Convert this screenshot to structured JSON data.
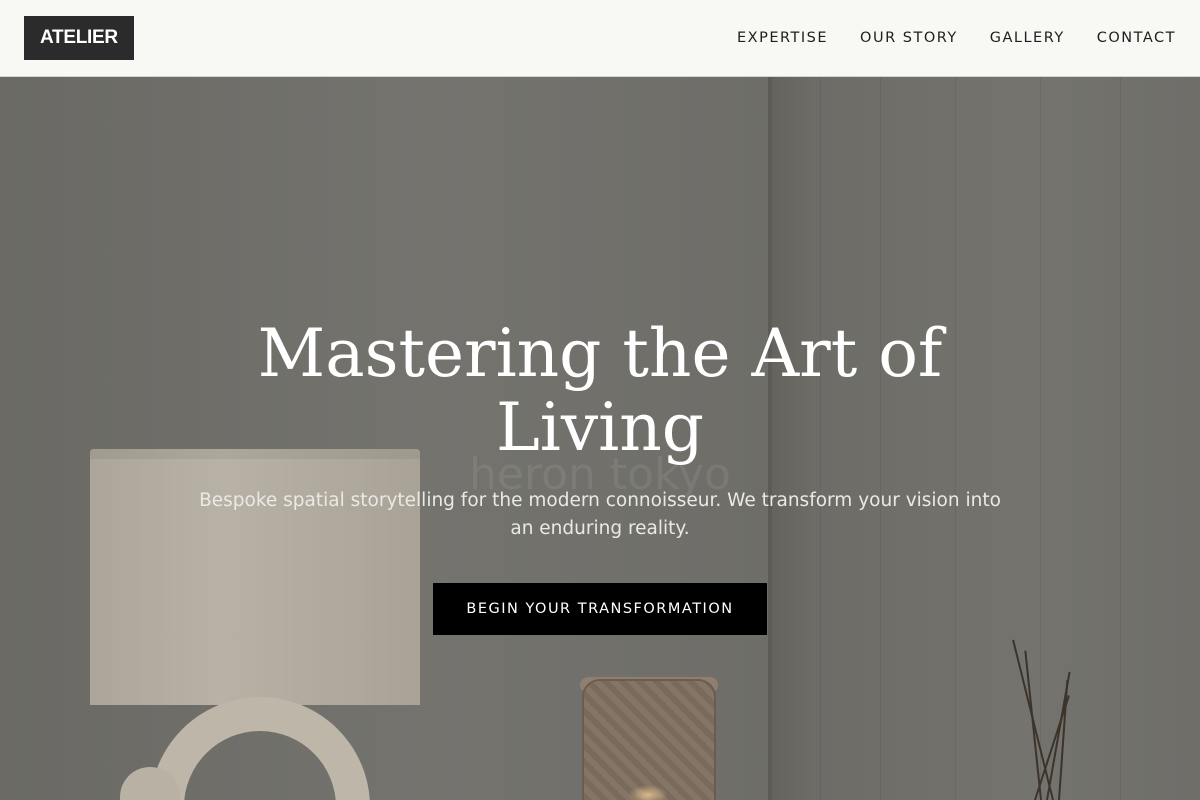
{
  "header": {
    "logo": "ATELIER",
    "nav": [
      {
        "label": "EXPERTISE"
      },
      {
        "label": "OUR STORY"
      },
      {
        "label": "GALLERY"
      },
      {
        "label": "CONTACT"
      }
    ]
  },
  "hero": {
    "headline_line1": "Mastering the Art of",
    "headline_line2": "Living",
    "subtitle_line1": "Bespoke spatial storytelling for the modern connoisseur. We transform your vision into",
    "subtitle_line2": "an enduring reality.",
    "cta_label": "BEGIN YOUR TRANSFORMATION",
    "background_watermark": "heron tokyo"
  },
  "colors": {
    "header_bg": "#f8f8f4",
    "logo_bg": "#2b2b2b",
    "cta_bg": "#000000",
    "hero_overlay": "#6f6e69",
    "text_light": "#ffffff"
  },
  "icons": []
}
